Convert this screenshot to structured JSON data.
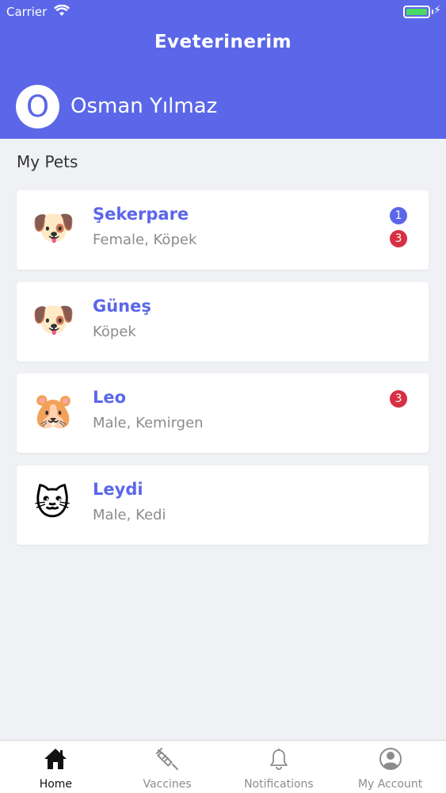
{
  "status_bar": {
    "carrier": "Carrier"
  },
  "header": {
    "app_title": "Eveterinerim",
    "avatar_initial": "O",
    "user_name": "Osman Yılmaz"
  },
  "section_title": "My Pets",
  "pets": [
    {
      "name": "Şekerpare",
      "desc": "Female,  Köpek",
      "icon": "dog-face-icon",
      "badges": [
        "1",
        "3"
      ]
    },
    {
      "name": "Güneş",
      "desc": "Köpek",
      "icon": "dog-face-icon",
      "badges": []
    },
    {
      "name": "Leo",
      "desc": "Male,  Kemirgen",
      "icon": "hamster-face-icon",
      "badges": [
        "3"
      ]
    },
    {
      "name": "Leydi",
      "desc": "Male,  Kedi",
      "icon": "cat-face-icon",
      "badges": []
    }
  ],
  "tabs": [
    {
      "label": "Home",
      "icon": "home-icon",
      "active": true
    },
    {
      "label": "Vaccines",
      "icon": "syringe-icon",
      "active": false
    },
    {
      "label": "Notifications",
      "icon": "bell-icon",
      "active": false
    },
    {
      "label": "My Account",
      "icon": "account-icon",
      "active": false
    }
  ],
  "colors": {
    "accent": "#5b67e8",
    "badge_red": "#d72f43",
    "background": "#eff1f4"
  }
}
